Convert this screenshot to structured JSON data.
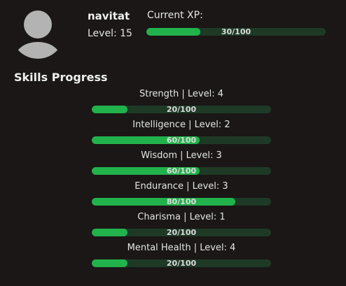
{
  "profile": {
    "username": "navitat",
    "level_text": "Level: 15",
    "xp_label": "Current XP:",
    "xp_text": "30/100",
    "xp_fraction": 0.3
  },
  "skills_title": "Skills Progress",
  "skills": [
    {
      "label": "Strength | Level: 4",
      "progress_text": "20/100",
      "fraction": 0.2
    },
    {
      "label": "Intelligence | Level: 2",
      "progress_text": "60/100",
      "fraction": 0.6
    },
    {
      "label": "Wisdom | Level: 3",
      "progress_text": "60/100",
      "fraction": 0.6
    },
    {
      "label": "Endurance | Level: 3",
      "progress_text": "80/100",
      "fraction": 0.8
    },
    {
      "label": "Charisma | Level: 1",
      "progress_text": "20/100",
      "fraction": 0.2
    },
    {
      "label": "Mental Health | Level: 4",
      "progress_text": "20/100",
      "fraction": 0.2
    }
  ],
  "colors": {
    "bar_fill": "#22b24c",
    "bar_track": "#1e3a26",
    "background": "#1a1716"
  },
  "icons": {
    "avatar": "user-silhouette-icon"
  }
}
